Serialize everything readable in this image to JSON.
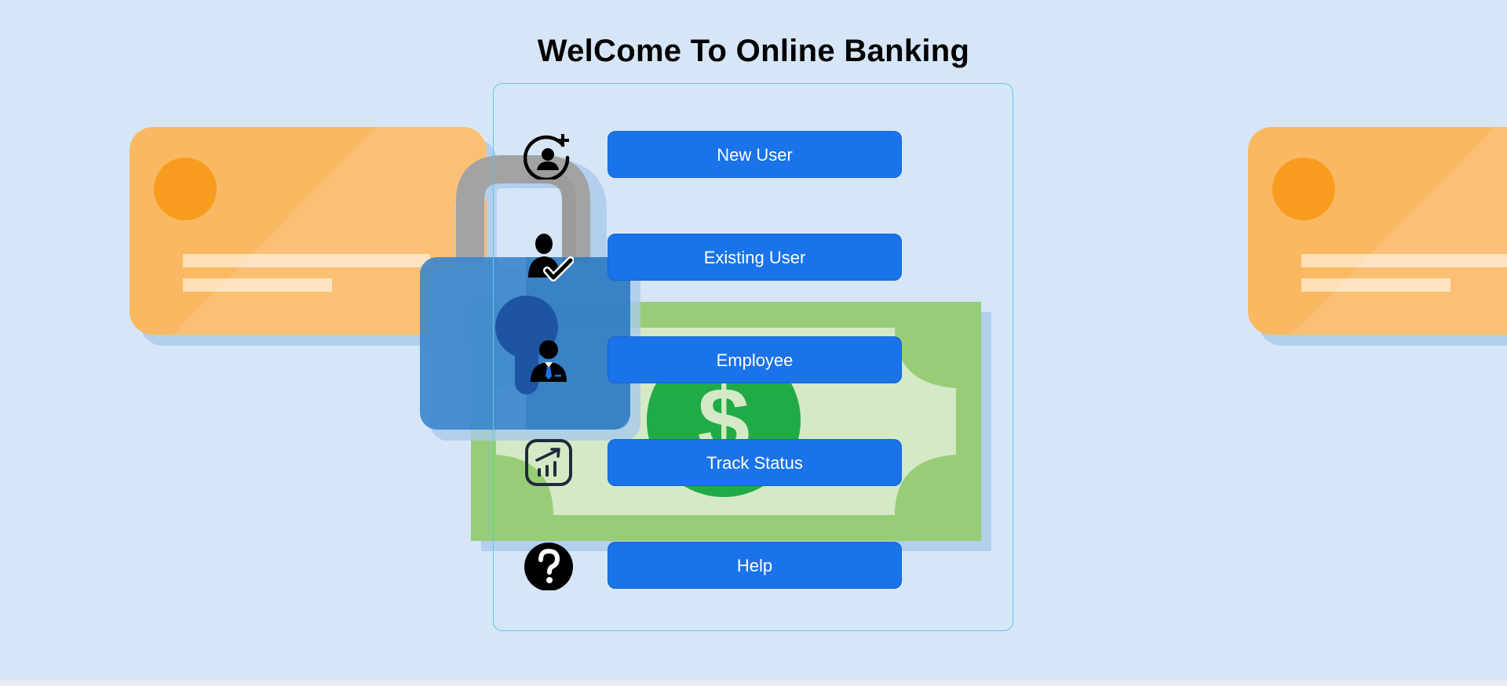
{
  "header": {
    "title": "WelCome To Online Banking"
  },
  "menu": {
    "items": [
      {
        "label": "New User",
        "icon": "add-user-icon"
      },
      {
        "label": "Existing User",
        "icon": "verified-user-icon"
      },
      {
        "label": "Employee",
        "icon": "employee-icon"
      },
      {
        "label": "Track Status",
        "icon": "chart-growth-icon"
      },
      {
        "label": "Help",
        "icon": "help-icon"
      }
    ]
  },
  "background": {
    "illustrations": [
      "credit-card-illustration",
      "padlock-illustration",
      "banknote-illustration",
      "credit-card-illustration"
    ],
    "colors": {
      "card": "#fbb862",
      "card_circle": "#f79c1f",
      "lock_body": "#3a86cc",
      "lock_shackle": "#a3a3a3",
      "note": "#97cd76",
      "note_inner": "#d4e9c5",
      "coin": "#21ab47"
    }
  },
  "colors": {
    "background": "#d6e6f7",
    "button": "#1a73e8",
    "button_text": "#ffffff",
    "panel_border": "#66c2e8",
    "title": "#000000"
  }
}
